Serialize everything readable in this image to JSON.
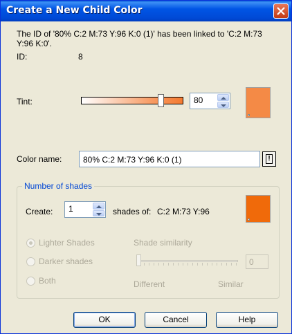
{
  "window": {
    "title": "Create a New Child Color"
  },
  "info": {
    "message": "The ID of '80% C:2 M:73 Y:96 K:0 (1)' has been linked to 'C:2 M:73 Y:96 K:0'.",
    "id_label": "ID:",
    "id_value": "8"
  },
  "tint": {
    "label": "Tint:",
    "value": "80",
    "swatch_color": "#f48a46"
  },
  "color_name": {
    "label": "Color name:",
    "value": "80% C:2 M:73 Y:96 K:0 (1)"
  },
  "shades": {
    "group_label": "Number of shades",
    "create_label": "Create:",
    "create_value": "1",
    "shades_of_label": "shades of:",
    "shades_of_value": "C:2 M:73 Y:96",
    "swatch_color": "#f06a0a",
    "options": [
      "Lighter Shades",
      "Darker shades",
      "Both"
    ],
    "selected_option": "Lighter Shades",
    "similarity_label": "Shade similarity",
    "similarity_value": "0",
    "scale_min": "Different",
    "scale_max": "Similar"
  },
  "buttons": {
    "ok": "OK",
    "cancel": "Cancel",
    "help": "Help"
  }
}
